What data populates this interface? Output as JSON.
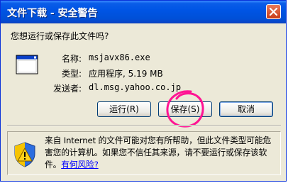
{
  "window": {
    "title": "文件下载 - 安全警告"
  },
  "question": "您想运行或保存此文件吗?",
  "file": {
    "name_label": "名称:",
    "name_value": "msjavx86.exe",
    "type_label": "类型:",
    "type_value": "应用程序, 5.19 MB",
    "from_label": "发送者:",
    "from_value": "dl.msg.yahoo.co.jp"
  },
  "buttons": {
    "run": "运行(R)",
    "save": "保存(S)",
    "cancel": "取消"
  },
  "warning": {
    "text": "来自 Internet 的文件可能对您有所帮助，但此文件类型可能危害您的计算机。如果您不信任其来源，请不要运行或保存该软件。",
    "link": "有何风险?"
  },
  "colors": {
    "titlebar": "#0055e5",
    "dialog_bg": "#ece9d8",
    "link": "#0000ff",
    "annotation": "#ff1493"
  }
}
